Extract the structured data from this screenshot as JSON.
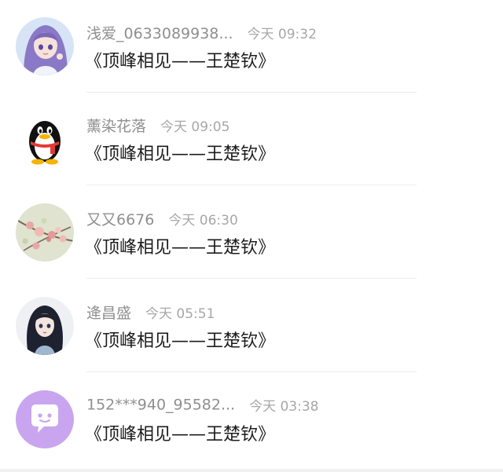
{
  "messages": [
    {
      "name": "浅爱_0633089938...",
      "time": "今天 09:32",
      "message": "《顶峰相见——王楚钦》",
      "avatar": "anime-girl-avatar"
    },
    {
      "name": "薰染花落",
      "time": "今天 09:05",
      "message": "《顶峰相见——王楚钦》",
      "avatar": "qq-penguin-avatar"
    },
    {
      "name": "又又6676",
      "time": "今天 06:30",
      "message": "《顶峰相见——王楚钦》",
      "avatar": "flower-branch-avatar"
    },
    {
      "name": "逄昌盛",
      "time": "今天 05:51",
      "message": "《顶峰相见——王楚钦》",
      "avatar": "dark-hair-girl-avatar"
    },
    {
      "name": "152***940_95582...",
      "time": "今天 03:38",
      "message": "《顶峰相见——王楚钦》",
      "avatar": "chat-bubble-avatar"
    }
  ],
  "colors": {
    "name_text": "#8f8f8f",
    "time_text": "#a7a7a7",
    "message_text": "#1c1c1c",
    "divider": "#ededed",
    "chat_avatar_bg": "#c9a5f0"
  }
}
